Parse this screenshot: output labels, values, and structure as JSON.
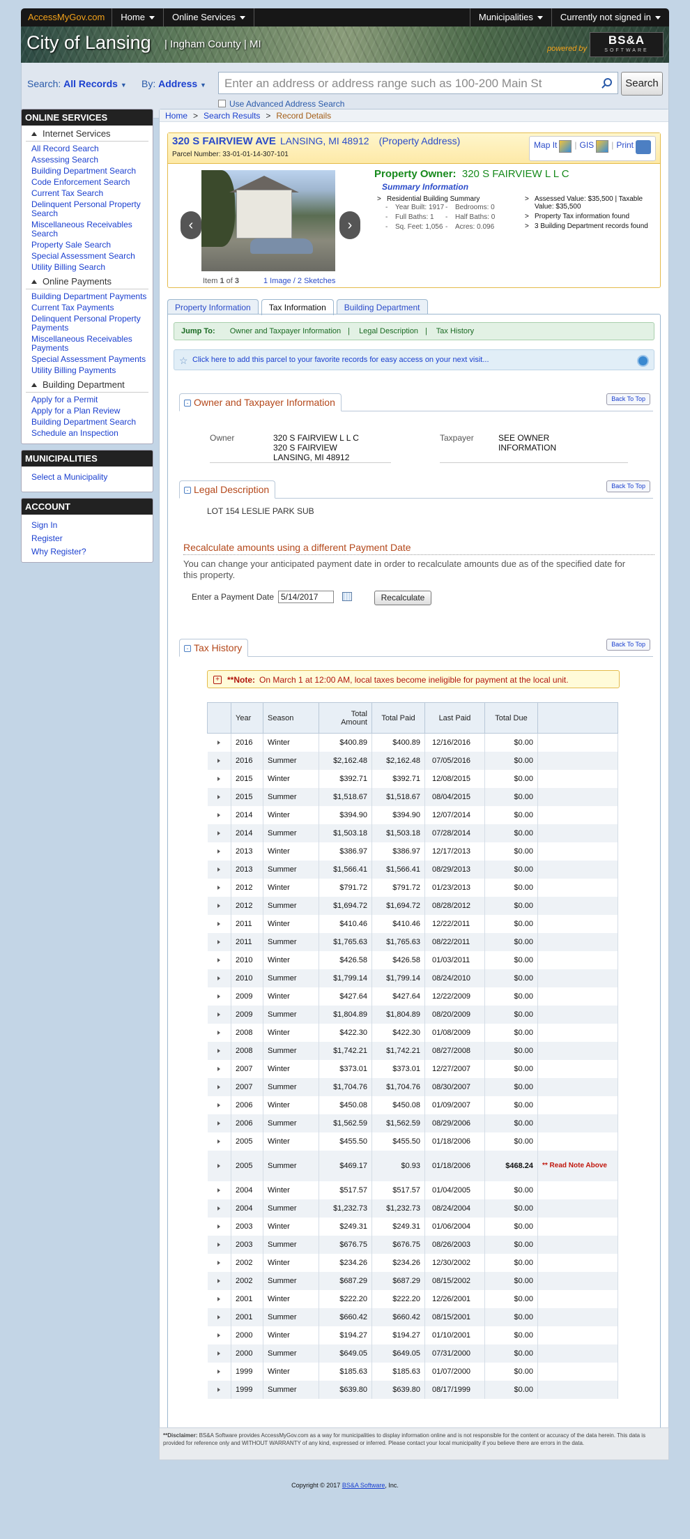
{
  "topnav": {
    "brand": "AccessMyGov.com",
    "home": "Home",
    "online_services": "Online Services",
    "municipalities": "Municipalities",
    "signin": "Currently not signed in"
  },
  "banner": {
    "city": "City of Lansing",
    "county": "Ingham County",
    "state": "MI",
    "powered_by": "powered by",
    "logo_text": "BS&A",
    "logo_sub": "SOFTWARE"
  },
  "search": {
    "label": "Search:",
    "scope": "All Records",
    "by_label": "By:",
    "by_value": "Address",
    "placeholder": "Enter an address or address range such as 100-200 Main St",
    "button": "Search",
    "advanced": "Use Advanced Address Search"
  },
  "sidebar": {
    "online_services_title": "ONLINE SERVICES",
    "internet_services": "Internet Services",
    "internet_links": [
      "All Record Search",
      "Assessing Search",
      "Building Department Search",
      "Code Enforcement Search",
      "Current Tax Search",
      "Delinquent Personal Property Search",
      "Miscellaneous Receivables Search",
      "Property Sale Search",
      "Special Assessment Search",
      "Utility Billing Search"
    ],
    "online_payments": "Online Payments",
    "payment_links": [
      "Building Department Payments",
      "Current Tax Payments",
      "Delinquent Personal Property Payments",
      "Miscellaneous Receivables Payments",
      "Special Assessment Payments",
      "Utility Billing Payments"
    ],
    "building_department": "Building Department",
    "building_links": [
      "Apply for a Permit",
      "Apply for a Plan Review",
      "Building Department Search",
      "Schedule an Inspection"
    ],
    "municipalities_title": "MUNICIPALITIES",
    "select_municipality": "Select a Municipality",
    "account_title": "ACCOUNT",
    "account_links": [
      "Sign In",
      "Register",
      "Why Register?"
    ]
  },
  "breadcrumb": [
    "Home",
    "Search Results",
    "Record Details"
  ],
  "property": {
    "address": "320 S FAIRVIEW AVE",
    "city": "LANSING, MI 48912",
    "type": "(Property Address)",
    "parcel": "Parcel Number: 33-01-01-14-307-101",
    "map_it": "Map It",
    "gis": "GIS",
    "print": "Print",
    "item_text": "Item",
    "item_num": "1",
    "of_text": "of",
    "item_total": "3",
    "images_link": "1 Image / 2 Sketches",
    "owner_label": "Property Owner:",
    "owner_name": "320 S FAIRVIEW L L C",
    "summary_title": "Summary Information",
    "summary_left": {
      "heading": "Residential Building Summary",
      "year_built": "Year Built: 1917",
      "bedrooms": "Bedrooms: 0",
      "full_baths": "Full Baths: 1",
      "half_baths": "Half Baths: 0",
      "sq_feet": "Sq. Feet: 1,056",
      "acres": "Acres: 0.096"
    },
    "summary_right": [
      "Assessed Value: $35,500 | Taxable Value: $35,500",
      "Property Tax information found",
      "3 Building Department records found"
    ]
  },
  "tabs": [
    "Property Information",
    "Tax Information",
    "Building Department"
  ],
  "jump": {
    "label": "Jump To:",
    "links": [
      "Owner and Taxpayer Information",
      "Legal Description",
      "Tax History"
    ]
  },
  "favorite_text": "Click here to add this parcel to your favorite records for easy access on your next visit...",
  "owner_section": {
    "title": "Owner and Taxpayer Information",
    "back_to_top": "Back To Top",
    "owner_label": "Owner",
    "owner_value": [
      "320 S FAIRVIEW L L C",
      "320 S FAIRVIEW",
      "LANSING, MI 48912"
    ],
    "taxpayer_label": "Taxpayer",
    "taxpayer_value": [
      "SEE OWNER",
      "INFORMATION"
    ]
  },
  "legal_section": {
    "title": "Legal Description",
    "back_to_top": "Back To Top",
    "text": "LOT 154 LESLIE PARK SUB"
  },
  "recalc": {
    "title": "Recalculate amounts using a different Payment Date",
    "description": "You can change your anticipated payment date in order to recalculate amounts due as of the specified date for this property.",
    "label": "Enter a Payment Date",
    "date": "5/14/2017",
    "button": "Recalculate"
  },
  "tax_history": {
    "title": "Tax History",
    "back_to_top": "Back To Top",
    "note_label": "**Note:",
    "note_text": "On March 1 at 12:00 AM, local taxes become ineligible for payment at the local unit.",
    "headers": [
      "Year",
      "Season",
      "Total Amount",
      "Total Paid",
      "Last Paid",
      "Total Due"
    ],
    "rows": [
      [
        "2016",
        "Winter",
        "$400.89",
        "$400.89",
        "12/16/2016",
        "$0.00",
        ""
      ],
      [
        "2016",
        "Summer",
        "$2,162.48",
        "$2,162.48",
        "07/05/2016",
        "$0.00",
        ""
      ],
      [
        "2015",
        "Winter",
        "$392.71",
        "$392.71",
        "12/08/2015",
        "$0.00",
        ""
      ],
      [
        "2015",
        "Summer",
        "$1,518.67",
        "$1,518.67",
        "08/04/2015",
        "$0.00",
        ""
      ],
      [
        "2014",
        "Winter",
        "$394.90",
        "$394.90",
        "12/07/2014",
        "$0.00",
        ""
      ],
      [
        "2014",
        "Summer",
        "$1,503.18",
        "$1,503.18",
        "07/28/2014",
        "$0.00",
        ""
      ],
      [
        "2013",
        "Winter",
        "$386.97",
        "$386.97",
        "12/17/2013",
        "$0.00",
        ""
      ],
      [
        "2013",
        "Summer",
        "$1,566.41",
        "$1,566.41",
        "08/29/2013",
        "$0.00",
        ""
      ],
      [
        "2012",
        "Winter",
        "$791.72",
        "$791.72",
        "01/23/2013",
        "$0.00",
        ""
      ],
      [
        "2012",
        "Summer",
        "$1,694.72",
        "$1,694.72",
        "08/28/2012",
        "$0.00",
        ""
      ],
      [
        "2011",
        "Winter",
        "$410.46",
        "$410.46",
        "12/22/2011",
        "$0.00",
        ""
      ],
      [
        "2011",
        "Summer",
        "$1,765.63",
        "$1,765.63",
        "08/22/2011",
        "$0.00",
        ""
      ],
      [
        "2010",
        "Winter",
        "$426.58",
        "$426.58",
        "01/03/2011",
        "$0.00",
        ""
      ],
      [
        "2010",
        "Summer",
        "$1,799.14",
        "$1,799.14",
        "08/24/2010",
        "$0.00",
        ""
      ],
      [
        "2009",
        "Winter",
        "$427.64",
        "$427.64",
        "12/22/2009",
        "$0.00",
        ""
      ],
      [
        "2009",
        "Summer",
        "$1,804.89",
        "$1,804.89",
        "08/20/2009",
        "$0.00",
        ""
      ],
      [
        "2008",
        "Winter",
        "$422.30",
        "$422.30",
        "01/08/2009",
        "$0.00",
        ""
      ],
      [
        "2008",
        "Summer",
        "$1,742.21",
        "$1,742.21",
        "08/27/2008",
        "$0.00",
        ""
      ],
      [
        "2007",
        "Winter",
        "$373.01",
        "$373.01",
        "12/27/2007",
        "$0.00",
        ""
      ],
      [
        "2007",
        "Summer",
        "$1,704.76",
        "$1,704.76",
        "08/30/2007",
        "$0.00",
        ""
      ],
      [
        "2006",
        "Winter",
        "$450.08",
        "$450.08",
        "01/09/2007",
        "$0.00",
        ""
      ],
      [
        "2006",
        "Summer",
        "$1,562.59",
        "$1,562.59",
        "08/29/2006",
        "$0.00",
        ""
      ],
      [
        "2005",
        "Winter",
        "$455.50",
        "$455.50",
        "01/18/2006",
        "$0.00",
        ""
      ],
      [
        "2005",
        "Summer",
        "$469.17",
        "$0.93",
        "01/18/2006",
        "$468.24",
        "** Read Note Above"
      ],
      [
        "2004",
        "Winter",
        "$517.57",
        "$517.57",
        "01/04/2005",
        "$0.00",
        ""
      ],
      [
        "2004",
        "Summer",
        "$1,232.73",
        "$1,232.73",
        "08/24/2004",
        "$0.00",
        ""
      ],
      [
        "2003",
        "Winter",
        "$249.31",
        "$249.31",
        "01/06/2004",
        "$0.00",
        ""
      ],
      [
        "2003",
        "Summer",
        "$676.75",
        "$676.75",
        "08/26/2003",
        "$0.00",
        ""
      ],
      [
        "2002",
        "Winter",
        "$234.26",
        "$234.26",
        "12/30/2002",
        "$0.00",
        ""
      ],
      [
        "2002",
        "Summer",
        "$687.29",
        "$687.29",
        "08/15/2002",
        "$0.00",
        ""
      ],
      [
        "2001",
        "Winter",
        "$222.20",
        "$222.20",
        "12/26/2001",
        "$0.00",
        ""
      ],
      [
        "2001",
        "Summer",
        "$660.42",
        "$660.42",
        "08/15/2001",
        "$0.00",
        ""
      ],
      [
        "2000",
        "Winter",
        "$194.27",
        "$194.27",
        "01/10/2001",
        "$0.00",
        ""
      ],
      [
        "2000",
        "Summer",
        "$649.05",
        "$649.05",
        "07/31/2000",
        "$0.00",
        ""
      ],
      [
        "1999",
        "Winter",
        "$185.63",
        "$185.63",
        "01/07/2000",
        "$0.00",
        ""
      ],
      [
        "1999",
        "Summer",
        "$639.80",
        "$639.80",
        "08/17/1999",
        "$0.00",
        ""
      ]
    ]
  },
  "disclaimer": {
    "label": "**Disclaimer:",
    "text": "BS&A Software provides AccessMyGov.com as a way for municipalities to display information online and is not responsible for the content or accuracy of the data herein. This data is provided for reference only and WITHOUT WARRANTY of any kind, expressed or inferred. Please contact your local municipality if you believe there are errors in the data."
  },
  "footer": {
    "copyright": "Copyright © 2017",
    "company": "BS&A Software",
    "suffix": ", Inc."
  }
}
